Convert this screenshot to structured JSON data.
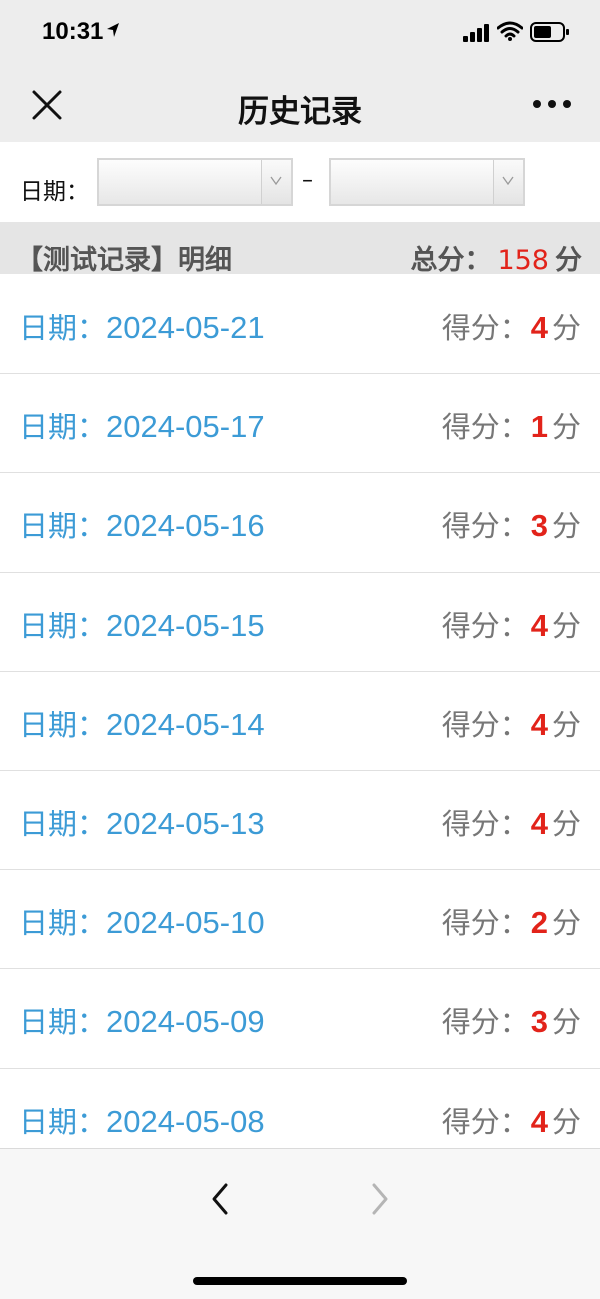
{
  "status_bar": {
    "time": "10:31",
    "icons": [
      "location-arrow-icon",
      "signal-icon",
      "wifi-icon",
      "battery-icon"
    ]
  },
  "nav": {
    "title": "历史记录",
    "close_icon": "close-icon",
    "more_icon": "more-icon"
  },
  "filter": {
    "label": "日期：",
    "start_date": "",
    "end_date": "",
    "separator": "–"
  },
  "summary": {
    "title": "【测试记录】明细",
    "total_label": "总分：",
    "total_value": "158",
    "total_unit": "分"
  },
  "records": [
    {
      "date_label": "日期：",
      "date": "2024-05-21",
      "score_label": "得分：",
      "score": "4",
      "unit": "分"
    },
    {
      "date_label": "日期：",
      "date": "2024-05-17",
      "score_label": "得分：",
      "score": "1",
      "unit": "分"
    },
    {
      "date_label": "日期：",
      "date": "2024-05-16",
      "score_label": "得分：",
      "score": "3",
      "unit": "分"
    },
    {
      "date_label": "日期：",
      "date": "2024-05-15",
      "score_label": "得分：",
      "score": "4",
      "unit": "分"
    },
    {
      "date_label": "日期：",
      "date": "2024-05-14",
      "score_label": "得分：",
      "score": "4",
      "unit": "分"
    },
    {
      "date_label": "日期：",
      "date": "2024-05-13",
      "score_label": "得分：",
      "score": "4",
      "unit": "分"
    },
    {
      "date_label": "日期：",
      "date": "2024-05-10",
      "score_label": "得分：",
      "score": "2",
      "unit": "分"
    },
    {
      "date_label": "日期：",
      "date": "2024-05-09",
      "score_label": "得分：",
      "score": "3",
      "unit": "分"
    },
    {
      "date_label": "日期：",
      "date": "2024-05-08",
      "score_label": "得分：",
      "score": "4",
      "unit": "分"
    }
  ],
  "toolbar": {
    "back_icon": "chevron-left-icon",
    "forward_icon": "chevron-right-icon"
  },
  "colors": {
    "accent_blue": "#3c9bd6",
    "score_red": "#e2231a",
    "header_bg": "#ededed"
  }
}
